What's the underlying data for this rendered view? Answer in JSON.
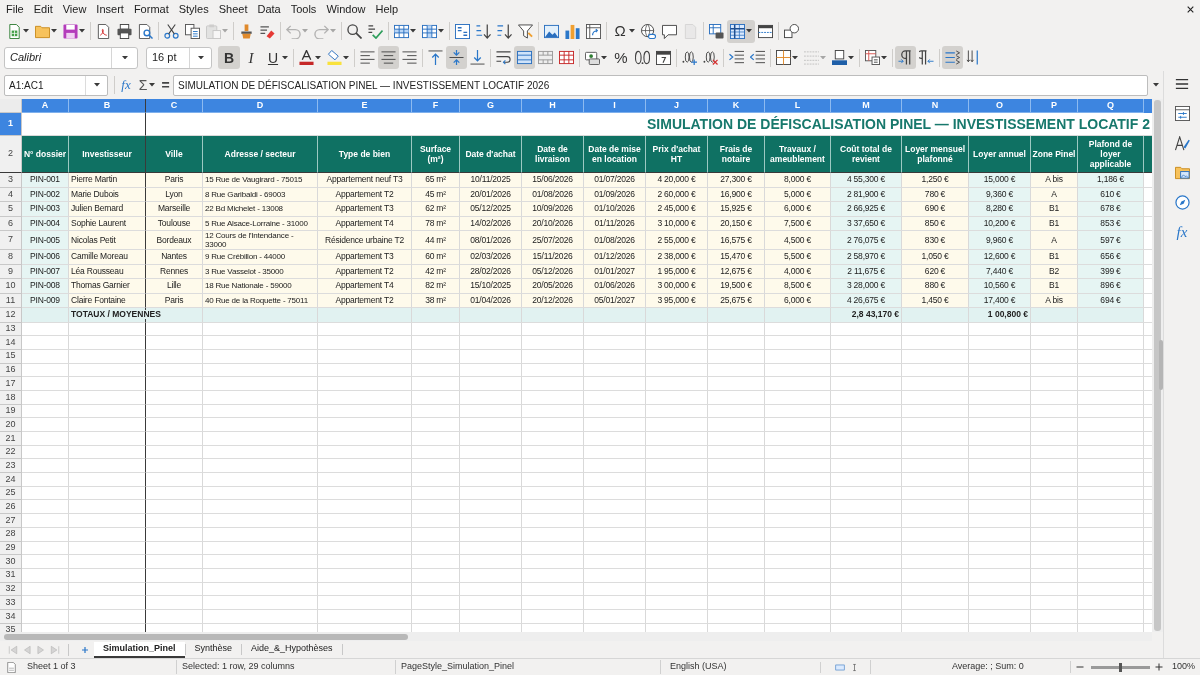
{
  "menu_bar": [
    "File",
    "Edit",
    "View",
    "Insert",
    "Format",
    "Styles",
    "Sheet",
    "Data",
    "Tools",
    "Window",
    "Help"
  ],
  "standard_toolbar": [
    {
      "kind": "icon",
      "pressed": false,
      "disabled": false
    },
    {
      "kind": "icon",
      "pressed": false,
      "disabled": false
    },
    {
      "kind": "icon",
      "pressed": false,
      "disabled": false
    },
    {
      "kind": "icon",
      "pressed": false,
      "disabled": false
    },
    {
      "kind": "icon",
      "pressed": false,
      "disabled": false
    },
    {
      "kind": "icon",
      "pressed": false,
      "disabled": false
    },
    {
      "kind": "icon",
      "pressed": false,
      "disabled": false
    },
    {
      "kind": "icon",
      "pressed": false,
      "disabled": false
    },
    {
      "kind": "icon",
      "pressed": false,
      "disabled": true
    },
    {
      "kind": "icon",
      "pressed": false,
      "disabled": false
    },
    {
      "kind": "icon",
      "pressed": false,
      "disabled": false
    },
    {
      "kind": "icon",
      "pressed": false,
      "disabled": true
    },
    {
      "kind": "icon",
      "pressed": false,
      "disabled": true
    },
    {
      "kind": "icon",
      "pressed": false,
      "disabled": false
    },
    {
      "kind": "icon",
      "pressed": false,
      "disabled": false
    },
    {
      "kind": "icon",
      "pressed": false,
      "disabled": false
    },
    {
      "kind": "icon",
      "pressed": false,
      "disabled": false
    },
    {
      "kind": "icon",
      "pressed": false,
      "disabled": false
    },
    {
      "kind": "icon",
      "pressed": false,
      "disabled": false
    },
    {
      "kind": "icon",
      "pressed": false,
      "disabled": false
    },
    {
      "kind": "icon",
      "pressed": false,
      "disabled": false
    },
    {
      "kind": "icon",
      "pressed": false,
      "disabled": false
    },
    {
      "kind": "icon",
      "pressed": false,
      "disabled": false
    },
    {
      "kind": "icon",
      "pressed": false,
      "disabled": false
    },
    {
      "kind": "text",
      "glyph": "Ω",
      "pressed": false,
      "disabled": false
    },
    {
      "kind": "icon",
      "pressed": false,
      "disabled": false
    },
    {
      "kind": "icon",
      "pressed": false,
      "disabled": false
    },
    {
      "kind": "icon",
      "pressed": false,
      "disabled": true
    },
    {
      "kind": "icon",
      "pressed": false,
      "disabled": false
    },
    {
      "kind": "icon",
      "pressed": true,
      "disabled": false
    },
    {
      "kind": "icon",
      "pressed": false,
      "disabled": false
    },
    {
      "kind": "icon",
      "pressed": false,
      "disabled": false
    }
  ],
  "formatting_toolbar": {
    "font_name": "Calibri",
    "font_size": "16 pt",
    "buttons": [
      {
        "kind": "text",
        "glyph": "B",
        "pressed": true,
        "disabled": false
      },
      {
        "kind": "text",
        "glyph": "I",
        "pressed": false,
        "disabled": false
      },
      {
        "kind": "text",
        "glyph": "U",
        "pressed": false,
        "disabled": false
      },
      {
        "kind": "icon",
        "pressed": false,
        "disabled": false
      },
      {
        "kind": "icon",
        "pressed": false,
        "disabled": false
      },
      {
        "kind": "icon",
        "pressed": false,
        "disabled": false
      },
      {
        "kind": "icon",
        "pressed": true,
        "disabled": false
      },
      {
        "kind": "icon",
        "pressed": false,
        "disabled": false
      },
      {
        "kind": "icon",
        "pressed": false,
        "disabled": false
      },
      {
        "kind": "icon",
        "pressed": true,
        "disabled": false
      },
      {
        "kind": "icon",
        "pressed": false,
        "disabled": false
      },
      {
        "kind": "icon",
        "pressed": false,
        "disabled": false
      },
      {
        "kind": "icon",
        "pressed": true,
        "disabled": false
      },
      {
        "kind": "icon",
        "pressed": false,
        "disabled": false
      },
      {
        "kind": "icon",
        "pressed": false,
        "disabled": false
      },
      {
        "kind": "icon",
        "pressed": false,
        "disabled": false
      },
      {
        "kind": "text",
        "glyph": "%",
        "pressed": false,
        "disabled": false
      },
      {
        "kind": "icon",
        "pressed": false,
        "disabled": false
      },
      {
        "kind": "icon",
        "pressed": false,
        "disabled": false
      },
      {
        "kind": "icon",
        "pressed": false,
        "disabled": false
      },
      {
        "kind": "icon",
        "pressed": false,
        "disabled": false
      },
      {
        "kind": "icon",
        "pressed": false,
        "disabled": false
      },
      {
        "kind": "icon",
        "pressed": false,
        "disabled": false
      },
      {
        "kind": "icon",
        "pressed": false,
        "disabled": false
      },
      {
        "kind": "icon",
        "pressed": false,
        "disabled": true
      },
      {
        "kind": "icon",
        "pressed": false,
        "disabled": false
      },
      {
        "kind": "icon",
        "pressed": false,
        "disabled": false
      },
      {
        "kind": "icon",
        "pressed": true,
        "disabled": false
      },
      {
        "kind": "icon",
        "pressed": false,
        "disabled": false
      },
      {
        "kind": "icon",
        "pressed": true,
        "disabled": false
      },
      {
        "kind": "icon",
        "pressed": false,
        "disabled": false
      }
    ]
  },
  "formula_bar": {
    "name_box": "A1:AC1",
    "function_glyph": "fx",
    "sum_glyph": "Σ",
    "equals_glyph": "=",
    "formula": "SIMULATION DE DÉFISCALISATION PINEL — INVESTISSEMENT LOCATIF 2026"
  },
  "sheet": {
    "columns": [
      {
        "letter": "A",
        "selected": true
      },
      {
        "letter": "B",
        "selected": true
      },
      {
        "letter": "C",
        "selected": true
      },
      {
        "letter": "D",
        "selected": true
      },
      {
        "letter": "E",
        "selected": true
      },
      {
        "letter": "F",
        "selected": true
      },
      {
        "letter": "G",
        "selected": true
      },
      {
        "letter": "H",
        "selected": true
      },
      {
        "letter": "I",
        "selected": true
      },
      {
        "letter": "J",
        "selected": true
      },
      {
        "letter": "K",
        "selected": true
      },
      {
        "letter": "L",
        "selected": true
      },
      {
        "letter": "M",
        "selected": true
      },
      {
        "letter": "N",
        "selected": true
      },
      {
        "letter": "O",
        "selected": true
      },
      {
        "letter": "P",
        "selected": true
      },
      {
        "letter": "Q",
        "selected": true
      }
    ],
    "title_row": {
      "number": "1",
      "selected": true,
      "title": "SIMULATION DE DÉFISCALISATION PINEL — INVESTISSEMENT LOCATIF 2"
    },
    "header_row": {
      "number": "2",
      "selected": false,
      "cells": [
        "N° dossier",
        "Investisseur",
        "Ville",
        "Adresse / secteur",
        "Type de bien",
        "Surface (m²)",
        "Date d'achat",
        "Date de livraison",
        "Date de mise en location",
        "Prix d'achat HT",
        "Frais de notaire",
        "Travaux / ameublement",
        "Coût total de revient",
        "Loyer mensuel plafonné",
        "Loyer annuel",
        "Zone Pinel",
        "Plafond de loyer applicable"
      ]
    },
    "rows": [
      {
        "number": "3",
        "selected": false,
        "cells": [
          "PIN-001",
          "Pierre Martin",
          "Paris",
          "15 Rue de Vaugirard - 75015",
          "Appartement neuf T3",
          "65 m²",
          "10/11/2025",
          "15/06/2026",
          "01/07/2026",
          "4 20,000 €",
          "27,300 €",
          "8,000 €",
          "4 55,300 €",
          "1,250 €",
          "15,000 €",
          "A bis",
          "1,186 €"
        ]
      },
      {
        "number": "4",
        "selected": false,
        "cells": [
          "PIN-002",
          "Marie Dubois",
          "Lyon",
          "8 Rue Garibaldi - 69003",
          "Appartement T2",
          "45 m²",
          "20/01/2026",
          "01/08/2026",
          "01/09/2026",
          "2 60,000 €",
          "16,900 €",
          "5,000 €",
          "2 81,900 €",
          "780 €",
          "9,360 €",
          "A",
          "610 €"
        ]
      },
      {
        "number": "5",
        "selected": false,
        "cells": [
          "PIN-003",
          "Julien Bernard",
          "Marseille",
          "22 Bd Michelet - 13008",
          "Appartement T3",
          "62 m²",
          "05/12/2025",
          "10/09/2026",
          "01/10/2026",
          "2 45,000 €",
          "15,925 €",
          "6,000 €",
          "2 66,925 €",
          "690 €",
          "8,280 €",
          "B1",
          "678 €"
        ]
      },
      {
        "number": "6",
        "selected": false,
        "cells": [
          "PIN-004",
          "Sophie Laurent",
          "Toulouse",
          "5 Rue Alsace-Lorraine - 31000",
          "Appartement T4",
          "78 m²",
          "14/02/2026",
          "20/10/2026",
          "01/11/2026",
          "3 10,000 €",
          "20,150 €",
          "7,500 €",
          "3 37,650 €",
          "850 €",
          "10,200 €",
          "B1",
          "853 €"
        ]
      },
      {
        "number": "7",
        "selected": false,
        "cells": [
          "PIN-005",
          "Nicolas Petit",
          "Bordeaux",
          "12 Cours de l'Intendance - 33000",
          "Résidence urbaine T2",
          "44 m²",
          "08/01/2026",
          "25/07/2026",
          "01/08/2026",
          "2 55,000 €",
          "16,575 €",
          "4,500 €",
          "2 76,075 €",
          "830 €",
          "9,960 €",
          "A",
          "597 €"
        ]
      },
      {
        "number": "8",
        "selected": false,
        "cells": [
          "PIN-006",
          "Camille Moreau",
          "Nantes",
          "9 Rue Crébillon - 44000",
          "Appartement T3",
          "60 m²",
          "02/03/2026",
          "15/11/2026",
          "01/12/2026",
          "2 38,000 €",
          "15,470 €",
          "5,500 €",
          "2 58,970 €",
          "1,050 €",
          "12,600 €",
          "B1",
          "656 €"
        ]
      },
      {
        "number": "9",
        "selected": false,
        "cells": [
          "PIN-007",
          "Léa Rousseau",
          "Rennes",
          "3 Rue Vasselot - 35000",
          "Appartement T2",
          "42 m²",
          "28/02/2026",
          "05/12/2026",
          "01/01/2027",
          "1 95,000 €",
          "12,675 €",
          "4,000 €",
          "2 11,675 €",
          "620 €",
          "7,440 €",
          "B2",
          "399 €"
        ]
      },
      {
        "number": "10",
        "selected": false,
        "cells": [
          "PIN-008",
          "Thomas Garnier",
          "Lille",
          "18 Rue Nationale - 59000",
          "Appartement T4",
          "82 m²",
          "15/10/2025",
          "20/05/2026",
          "01/06/2026",
          "3 00,000 €",
          "19,500 €",
          "8,500 €",
          "3 28,000 €",
          "880 €",
          "10,560 €",
          "B1",
          "896 €"
        ]
      },
      {
        "number": "11",
        "selected": false,
        "cells": [
          "PIN-009",
          "Claire Fontaine",
          "Paris",
          "40 Rue de la Roquette - 75011",
          "Appartement T2",
          "38 m²",
          "01/04/2026",
          "20/12/2026",
          "05/01/2027",
          "3 95,000 €",
          "25,675 €",
          "6,000 €",
          "4 26,675 €",
          "1,450 €",
          "17,400 €",
          "A bis",
          "694 €"
        ]
      }
    ],
    "totals_row": {
      "number": "12",
      "selected": false,
      "label": "TOTAUX / MOYENNES",
      "total_cost": "2,8 43,170 €",
      "annual_rent_total": "1 00,800 €"
    },
    "empty_rows": [
      {
        "number": "13",
        "selected": false
      },
      {
        "number": "14",
        "selected": false
      },
      {
        "number": "15",
        "selected": false
      },
      {
        "number": "16",
        "selected": false
      },
      {
        "number": "17",
        "selected": false
      },
      {
        "number": "18",
        "selected": false
      },
      {
        "number": "19",
        "selected": false
      },
      {
        "number": "20",
        "selected": false
      },
      {
        "number": "21",
        "selected": false
      },
      {
        "number": "22",
        "selected": false
      },
      {
        "number": "23",
        "selected": false
      },
      {
        "number": "24",
        "selected": false
      },
      {
        "number": "25",
        "selected": false
      },
      {
        "number": "26",
        "selected": false
      },
      {
        "number": "27",
        "selected": false
      },
      {
        "number": "28",
        "selected": false
      },
      {
        "number": "29",
        "selected": false
      },
      {
        "number": "30",
        "selected": false
      },
      {
        "number": "31",
        "selected": false
      },
      {
        "number": "32",
        "selected": false
      },
      {
        "number": "33",
        "selected": false
      },
      {
        "number": "34",
        "selected": false
      },
      {
        "number": "35",
        "selected": false
      }
    ]
  },
  "sidebar": {
    "functions_glyph": "fx"
  },
  "tab_navigation": [
    {
      "disabled": true
    },
    {
      "disabled": true
    },
    {
      "disabled": true
    },
    {
      "disabled": true
    }
  ],
  "sheet_tabs": [
    {
      "label": "Simulation_Pinel",
      "selected": true
    },
    {
      "label": "Synthèse",
      "selected": false
    },
    {
      "label": "Aide_&_Hypothèses",
      "selected": false
    }
  ],
  "status_bar": {
    "sheet_position": "Sheet 1 of 3",
    "selection": "Selected: 1 row, 29 columns",
    "page_style": "PageStyle_Simulation_Pinel",
    "language": "English (USA)",
    "summary": "Average: ; Sum: 0",
    "zoom": {
      "level": 0.5,
      "reading": "100%"
    }
  }
}
